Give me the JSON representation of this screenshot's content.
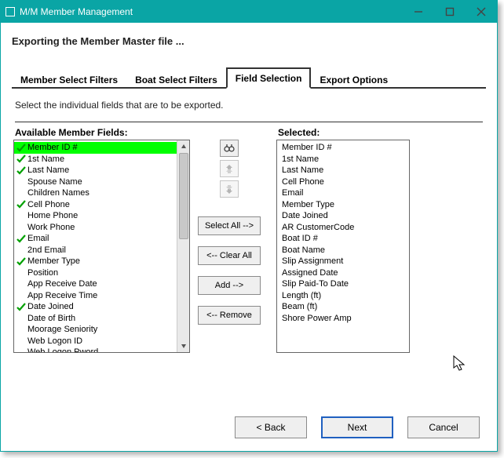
{
  "window": {
    "title": "M/M Member Management"
  },
  "subtitle": "Exporting the Member Master file ...",
  "tabs": [
    {
      "label": "Member Select Filters",
      "active": false
    },
    {
      "label": "Boat Select Filters",
      "active": false
    },
    {
      "label": "Field Selection",
      "active": true
    },
    {
      "label": "Export Options",
      "active": false
    }
  ],
  "instruction": "Select the individual fields that are to be exported.",
  "left_label": "Available Member Fields:",
  "right_label": "Selected:",
  "available": [
    {
      "label": "Member ID #",
      "checked": true,
      "highlight": true
    },
    {
      "label": "1st Name",
      "checked": true
    },
    {
      "label": "Last Name",
      "checked": true
    },
    {
      "label": "Spouse Name",
      "checked": false
    },
    {
      "label": "Children Names",
      "checked": false
    },
    {
      "label": "Cell Phone",
      "checked": true
    },
    {
      "label": "Home Phone",
      "checked": false
    },
    {
      "label": "Work Phone",
      "checked": false
    },
    {
      "label": "Email",
      "checked": true
    },
    {
      "label": "2nd Email",
      "checked": false
    },
    {
      "label": "Member Type",
      "checked": true
    },
    {
      "label": "Position",
      "checked": false
    },
    {
      "label": "App Receive Date",
      "checked": false
    },
    {
      "label": "App Receive Time",
      "checked": false
    },
    {
      "label": "Date Joined",
      "checked": true
    },
    {
      "label": "Date of Birth",
      "checked": false
    },
    {
      "label": "Moorage Seniority",
      "checked": false
    },
    {
      "label": "Web Logon ID",
      "checked": false
    },
    {
      "label": "Web Logon Pword",
      "checked": false
    }
  ],
  "selected": [
    "Member ID #",
    "1st Name",
    "Last Name",
    "Cell Phone",
    "Email",
    "Member Type",
    "Date Joined",
    "AR CustomerCode",
    "Boat ID #",
    "Boat Name",
    "Slip Assignment",
    "Assigned Date",
    "Slip Paid-To Date",
    "Length (ft)",
    "Beam (ft)",
    "Shore Power Amp"
  ],
  "buttons": {
    "select_all": "Select All -->",
    "clear_all": "<-- Clear All",
    "add": "Add -->",
    "remove": "<-- Remove"
  },
  "wizard": {
    "back": "< Back",
    "next": "Next",
    "cancel": "Cancel"
  }
}
